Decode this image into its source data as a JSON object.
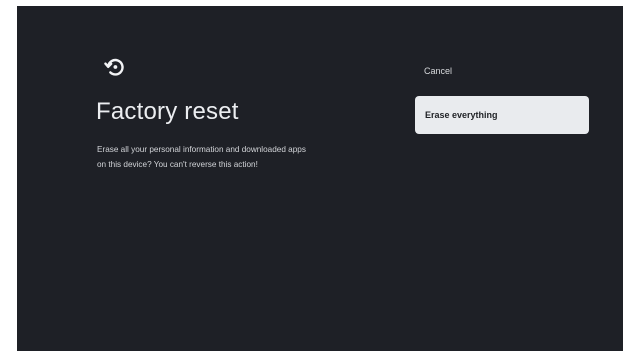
{
  "dialog": {
    "icon": "reset-icon",
    "title": "Factory reset",
    "description_line1": "Erase all your personal information and downloaded apps",
    "description_line2": "on this device? You can't reverse this action!"
  },
  "actions": {
    "cancel_label": "Cancel",
    "erase_label": "Erase everything"
  },
  "colors": {
    "background": "#1e2026",
    "focused_button": "#e9ebee",
    "text": "#e6e7ea"
  }
}
